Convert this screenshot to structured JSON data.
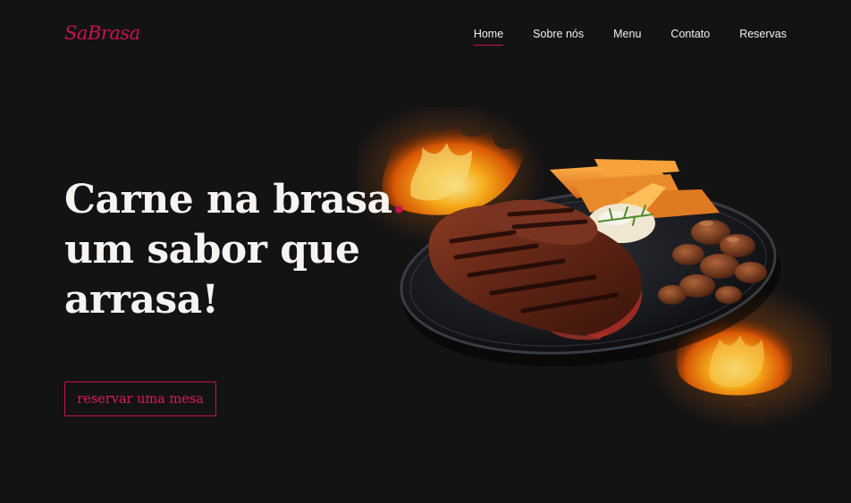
{
  "brand": {
    "logo": "SaBrasa"
  },
  "nav": {
    "items": [
      {
        "label": "Home",
        "active": true
      },
      {
        "label": "Sobre nós",
        "active": false
      },
      {
        "label": "Menu",
        "active": false
      },
      {
        "label": "Contato",
        "active": false
      },
      {
        "label": "Reservas",
        "active": false
      }
    ]
  },
  "hero": {
    "headline_part1": "Carne na brasa",
    "headline_dot": ".",
    "headline_line2": "um sabor que",
    "headline_line3": "arrasa!",
    "cta_label": "reservar uma mesa",
    "image_subject": "grilled-steak-plate-with-fries-mushrooms-and-flames"
  },
  "colors": {
    "background": "#141314",
    "accent": "#c8134f",
    "text": "#f7f3f1"
  }
}
